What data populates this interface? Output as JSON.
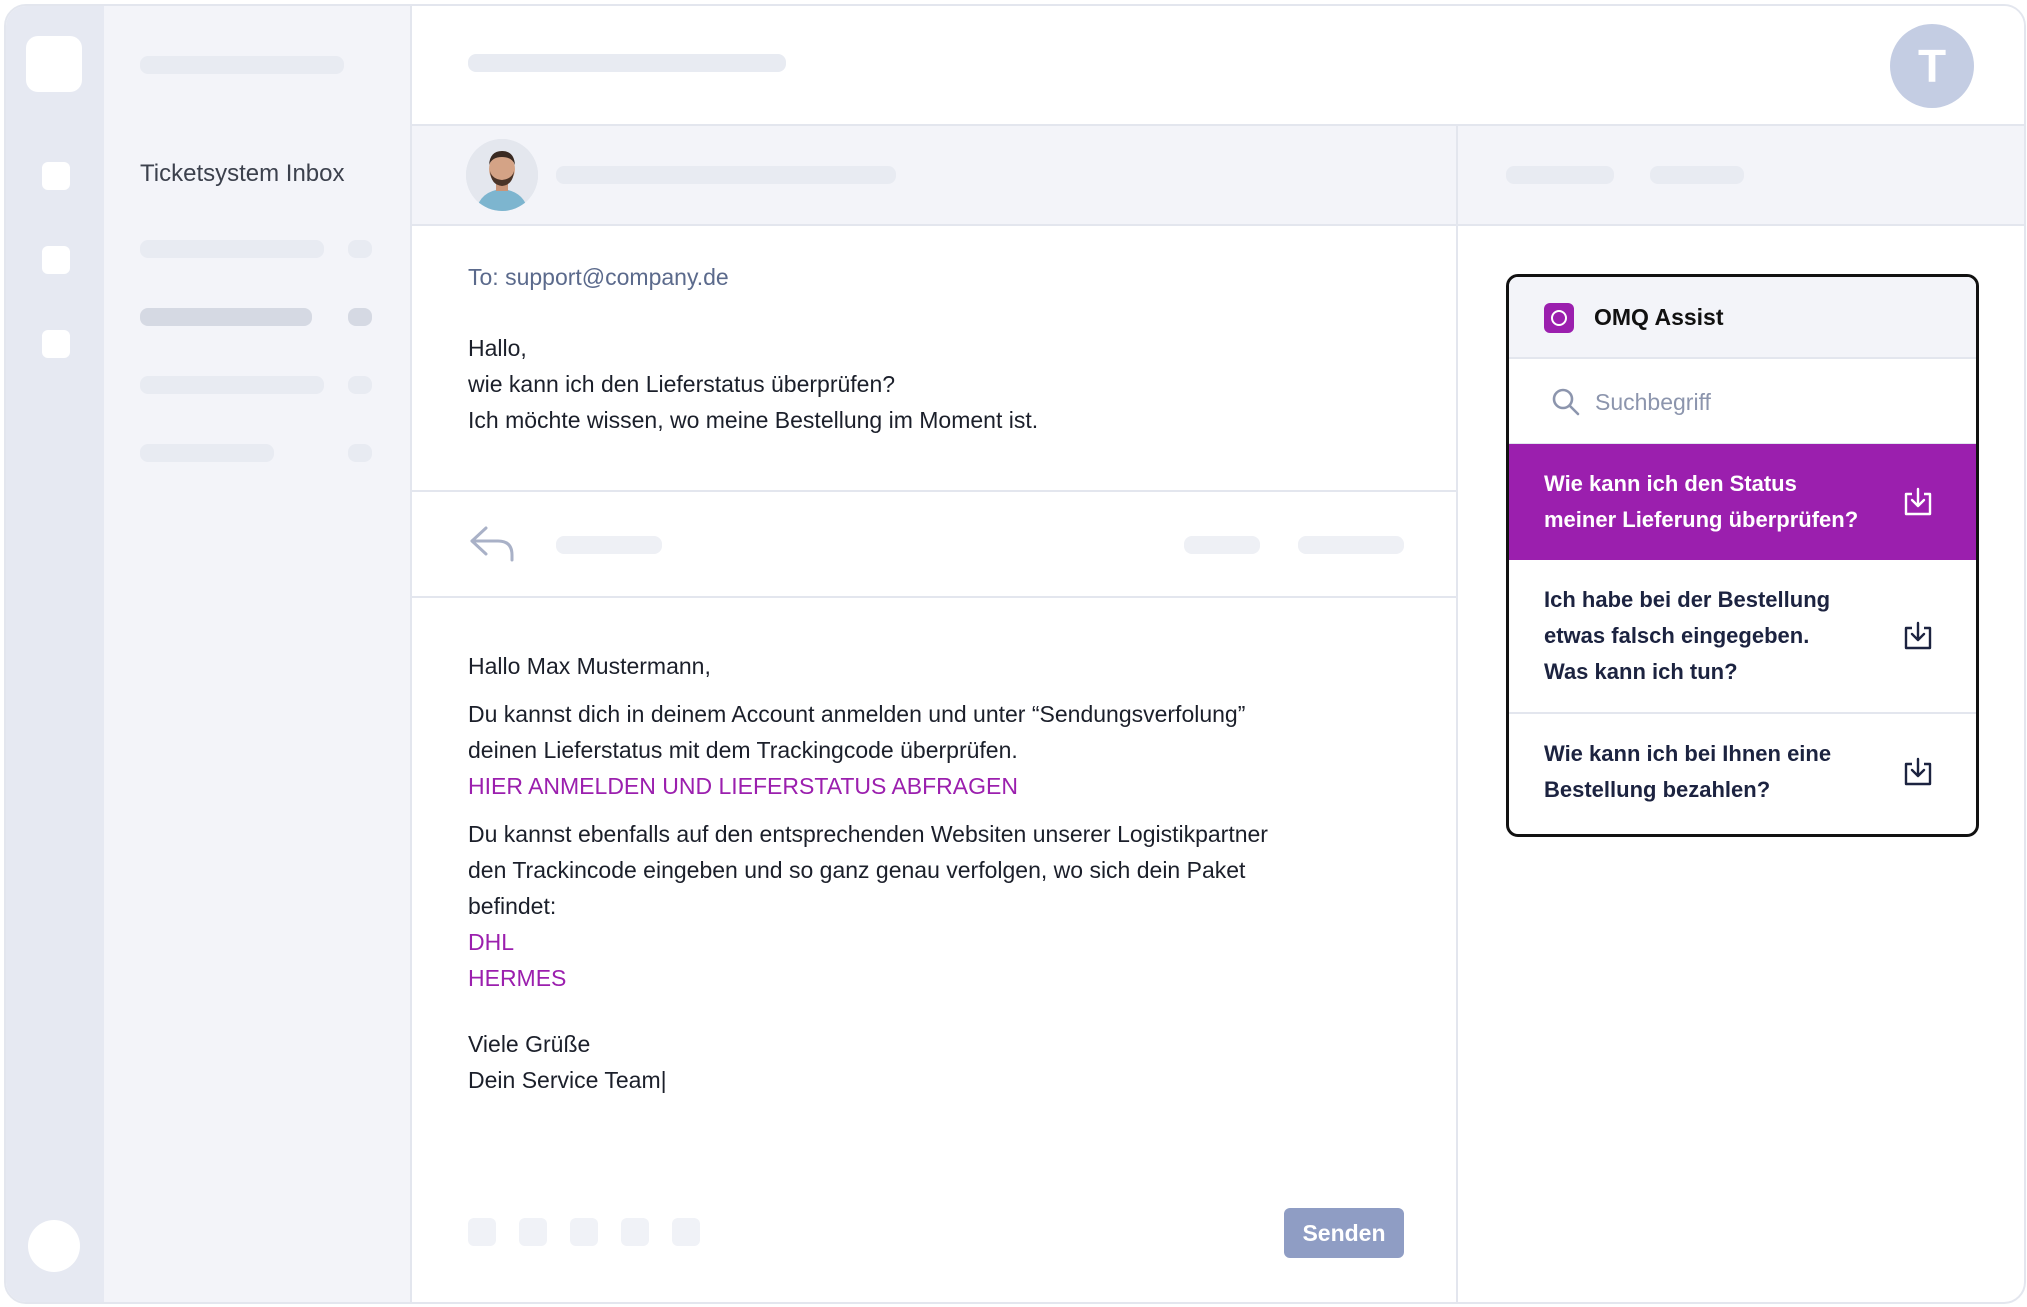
{
  "sidebar": {
    "title": "Ticketsystem Inbox"
  },
  "user": {
    "initial": "T"
  },
  "email": {
    "to": "To: support@company.de",
    "lines": [
      "Hallo,",
      "wie kann ich den Lieferstatus überprüfen?",
      "Ich möchte wissen, wo meine Bestellung im Moment ist."
    ]
  },
  "reply": {
    "greeting": "Hallo Max Mustermann,",
    "p1_line1": "Du kannst dich in deinem Account anmelden und unter “Sendungsverfolung”",
    "p1_line2": "deinen Lieferstatus mit dem Trackingcode überprüfen.",
    "p1_link": "HIER ANMELDEN UND LIEFERSTATUS ABFRAGEN",
    "p2_line1": "Du kannst ebenfalls auf den entsprechenden Websiten unserer Logistikpartner",
    "p2_line2": "den Trackincode eingeben und so ganz genau verfolgen, wo sich dein Paket",
    "p2_line3": "befindet:",
    "link_dhl": "DHL",
    "link_hermes": "HERMES",
    "closing1": "Viele Grüße",
    "closing2": "Dein Service Team",
    "caret": "|",
    "send_label": "Senden"
  },
  "assist": {
    "title": "OMQ Assist",
    "search_placeholder": "Suchbegriff",
    "suggestions": [
      {
        "line1": "Wie kann ich den Status",
        "line2": "meiner Lieferung überprüfen?",
        "line3": ""
      },
      {
        "line1": "Ich habe bei der Bestellung",
        "line2": "etwas falsch eingegeben.",
        "line3": "Was kann ich tun?"
      },
      {
        "line1": "Wie kann ich bei Ihnen eine",
        "line2": "Bestellung bezahlen?",
        "line3": ""
      }
    ]
  },
  "colors": {
    "accent": "#9b1fae",
    "send": "#8f9dc4",
    "avatar": "#c4cde3"
  }
}
